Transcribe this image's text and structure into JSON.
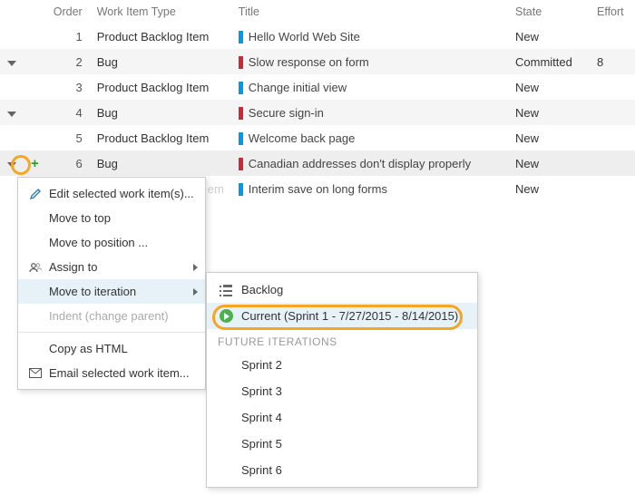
{
  "columns": {
    "order": "Order",
    "type": "Work Item Type",
    "title": "Title",
    "state": "State",
    "effort": "Effort"
  },
  "rows": [
    {
      "order": "1",
      "type": "Product Backlog Item",
      "bar": "blue",
      "title": "Hello World Web Site",
      "state": "New",
      "effort": "",
      "hasExpand": false,
      "alt": false
    },
    {
      "order": "2",
      "type": "Bug",
      "bar": "red",
      "title": "Slow response on form",
      "state": "Committed",
      "effort": "8",
      "hasExpand": true,
      "alt": true
    },
    {
      "order": "3",
      "type": "Product Backlog Item",
      "bar": "blue",
      "title": "Change initial view",
      "state": "New",
      "effort": "",
      "hasExpand": false,
      "alt": false
    },
    {
      "order": "4",
      "type": "Bug",
      "bar": "red",
      "title": "Secure sign-in",
      "state": "New",
      "effort": "",
      "hasExpand": true,
      "alt": true
    },
    {
      "order": "5",
      "type": "Product Backlog Item",
      "bar": "blue",
      "title": "Welcome back page",
      "state": "New",
      "effort": "",
      "hasExpand": false,
      "alt": false
    },
    {
      "order": "6",
      "type": "Bug",
      "bar": "red",
      "title": "Canadian addresses don't display properly",
      "state": "New",
      "effort": "",
      "hasExpand": true,
      "alt": true,
      "active": true,
      "showPlus": true
    },
    {
      "order": "7",
      "type": "Product Backlog Item",
      "bar": "blue",
      "title": "Interim save on long forms",
      "state": "New",
      "effort": "",
      "hasExpand": false,
      "alt": false,
      "hiddenType": true
    }
  ],
  "contextMenu": {
    "edit": "Edit selected work item(s)...",
    "moveTop": "Move to top",
    "movePos": "Move to position ...",
    "assign": "Assign to",
    "moveIter": "Move to iteration",
    "indent": "Indent (change parent)",
    "copyHtml": "Copy as HTML",
    "email": "Email selected work item..."
  },
  "submenu": {
    "backlog": "Backlog",
    "current": "Current (Sprint 1 - 7/27/2015 - 8/14/2015)",
    "futureHeader": "FUTURE ITERATIONS",
    "future": [
      "Sprint 2",
      "Sprint 3",
      "Sprint 4",
      "Sprint 5",
      "Sprint 6"
    ]
  }
}
